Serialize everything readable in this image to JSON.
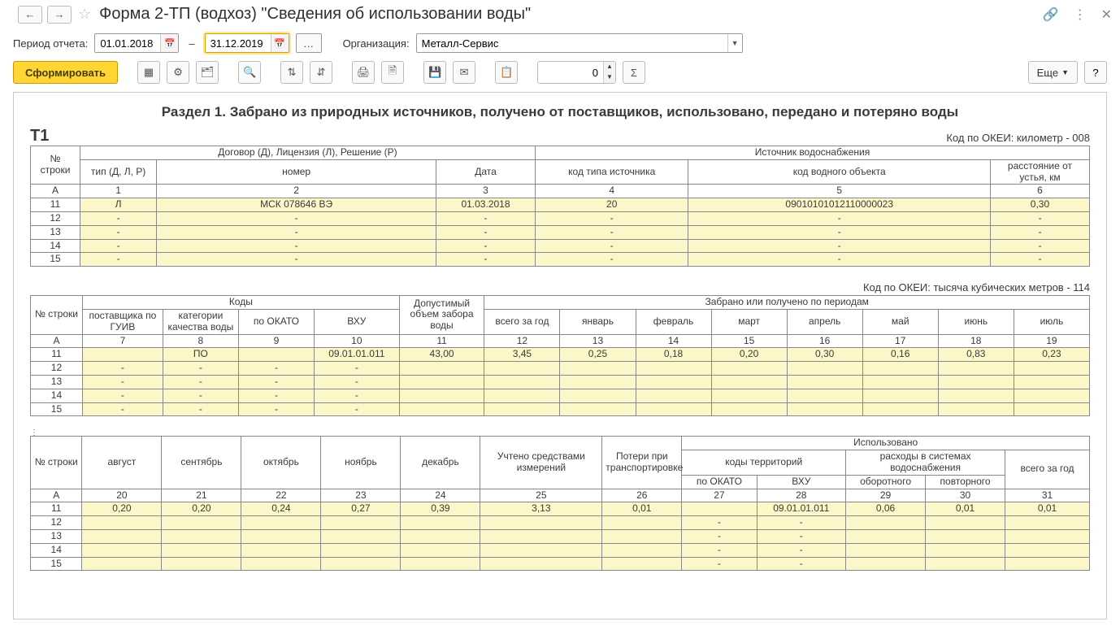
{
  "titlebar": {
    "title": "Форма 2-ТП (водхоз) \"Сведения об использовании воды\""
  },
  "params": {
    "period_label": "Период отчета:",
    "date_from": "01.01.2018",
    "dash": "–",
    "date_to": "31.12.2019",
    "org_label": "Организация:",
    "org_value": "Металл-Сервис"
  },
  "toolbar": {
    "form_btn": "Сформировать",
    "spin_value": "0",
    "more": "Еще"
  },
  "report": {
    "section_title": "Раздел 1. Забрано из природных источников, получено от поставщиков, использовано, передано и потеряно воды",
    "t1": "Т1",
    "okei1": "Код по ОКЕИ: километр - 008",
    "okei2": "Код по ОКЕИ: тысяча кубических метров - 114",
    "tbl1": {
      "hdr": {
        "rownum": "№ строки",
        "contract": "Договор (Д), Лицензия (Л), Решение (Р)",
        "source": "Источник водоснабжения",
        "type": "тип (Д, Л, Р)",
        "number": "номер",
        "date": "Дата",
        "src_code": "код типа источника",
        "water_code": "код водного объекта",
        "dist": "расстояние от устья, км"
      },
      "colA": "A",
      "cols": [
        "1",
        "2",
        "3",
        "4",
        "5",
        "6"
      ],
      "rows": [
        {
          "n": "11",
          "c": [
            "Л",
            "МСК 078646 ВЭ",
            "01.03.2018",
            "20",
            "09010101012110000023",
            "0,30"
          ]
        },
        {
          "n": "12",
          "c": [
            "-",
            "-",
            "-",
            "-",
            "-",
            "-"
          ]
        },
        {
          "n": "13",
          "c": [
            "-",
            "-",
            "-",
            "-",
            "-",
            "-"
          ]
        },
        {
          "n": "14",
          "c": [
            "-",
            "-",
            "-",
            "-",
            "-",
            "-"
          ]
        },
        {
          "n": "15",
          "c": [
            "-",
            "-",
            "-",
            "-",
            "-",
            "-"
          ]
        }
      ]
    },
    "tbl2": {
      "hdr": {
        "rownum": "№ строки",
        "codes": "Коды",
        "supplier": "поставщика по ГУИВ",
        "qcat": "категории качества воды",
        "okato": "по ОКАТО",
        "vhu": "ВХУ",
        "allowed": "Допустимый объем забора воды",
        "received": "Забрано или получено по периодам",
        "total": "всего за год",
        "jan": "январь",
        "feb": "февраль",
        "mar": "март",
        "apr": "апрель",
        "may": "май",
        "jun": "июнь",
        "jul": "июль"
      },
      "colA": "A",
      "cols": [
        "7",
        "8",
        "9",
        "10",
        "11",
        "12",
        "13",
        "14",
        "15",
        "16",
        "17",
        "18",
        "19"
      ],
      "rows": [
        {
          "n": "11",
          "c": [
            "",
            "ПО",
            "",
            "09.01.01.011",
            "43,00",
            "3,45",
            "0,25",
            "0,18",
            "0,20",
            "0,30",
            "0,16",
            "0,83",
            "0,23"
          ]
        },
        {
          "n": "12",
          "c": [
            "-",
            "-",
            "-",
            "-",
            "",
            "",
            "",
            "",
            "",
            "",
            "",
            "",
            ""
          ]
        },
        {
          "n": "13",
          "c": [
            "-",
            "-",
            "-",
            "-",
            "",
            "",
            "",
            "",
            "",
            "",
            "",
            "",
            ""
          ]
        },
        {
          "n": "14",
          "c": [
            "-",
            "-",
            "-",
            "-",
            "",
            "",
            "",
            "",
            "",
            "",
            "",
            "",
            ""
          ]
        },
        {
          "n": "15",
          "c": [
            "-",
            "-",
            "-",
            "-",
            "",
            "",
            "",
            "",
            "",
            "",
            "",
            "",
            ""
          ]
        }
      ]
    },
    "tbl3": {
      "hdr": {
        "rownum": "№ строки",
        "aug": "август",
        "sep": "сентябрь",
        "oct": "октябрь",
        "nov": "ноябрь",
        "dec": "декабрь",
        "measured": "Учтено средствами измерений",
        "loss": "Потери при транспортировке",
        "used": "Использовано",
        "terr": "коды территорий",
        "expenses": "расходы в системах водоснабжения",
        "okato": "по ОКАТО",
        "vhu": "ВХУ",
        "turn": "оборотного",
        "repeat": "повторного",
        "total": "всего за год"
      },
      "colA": "A",
      "cols": [
        "20",
        "21",
        "22",
        "23",
        "24",
        "25",
        "26",
        "27",
        "28",
        "29",
        "30",
        "31"
      ],
      "rows": [
        {
          "n": "11",
          "c": [
            "0,20",
            "0,20",
            "0,24",
            "0,27",
            "0,39",
            "3,13",
            "0,01",
            "",
            "09.01.01.011",
            "0,06",
            "0,01",
            "0,01"
          ]
        },
        {
          "n": "12",
          "c": [
            "",
            "",
            "",
            "",
            "",
            "",
            "",
            "-",
            "-",
            "",
            "",
            ""
          ]
        },
        {
          "n": "13",
          "c": [
            "",
            "",
            "",
            "",
            "",
            "",
            "",
            "-",
            "-",
            "",
            "",
            ""
          ]
        },
        {
          "n": "14",
          "c": [
            "",
            "",
            "",
            "",
            "",
            "",
            "",
            "-",
            "-",
            "",
            "",
            ""
          ]
        },
        {
          "n": "15",
          "c": [
            "",
            "",
            "",
            "",
            "",
            "",
            "",
            "-",
            "-",
            "",
            "",
            ""
          ]
        }
      ]
    }
  }
}
